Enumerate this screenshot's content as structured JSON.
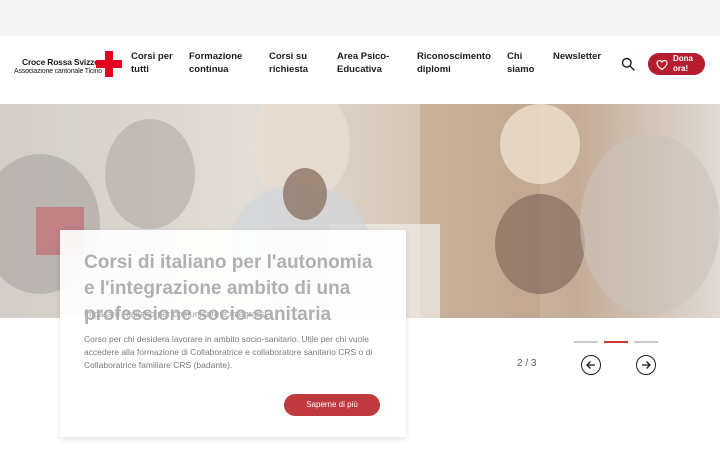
{
  "logo": {
    "name": "Croce Rossa Svizzera",
    "sub": "Associazione cantonale Ticino"
  },
  "nav": {
    "items": [
      {
        "label": "Corsi per tutti"
      },
      {
        "label": "Formazione continua"
      },
      {
        "label": "Corsi su richiesta"
      },
      {
        "label": "Area Psico-Educativa"
      },
      {
        "label": "Riconoscimento diplomi"
      },
      {
        "label": "Chi siamo"
      },
      {
        "label": "Newsletter"
      }
    ],
    "donate_label": "Dona ora!"
  },
  "colors": {
    "brand_red": "#e1001e",
    "button_red": "#b51d2e",
    "accent_red": "#c0392b"
  },
  "icons": {
    "search": "search-icon",
    "heart": "heart-icon",
    "prev": "arrow-left-icon",
    "next": "arrow-right-icon"
  },
  "slide": {
    "title": "Corsi di italiano per l'autonomia e l'integrazione ambito di una professione socio-sanitaria",
    "subtitle": "Imparare l'italiano per comunicare e integrarsi.",
    "body": "Corso per chi desidera lavorare in ambito socio-sanitario. Utile per chi vuole accedere alla formazione di Collaboratrice e collaboratore sanitario CRS o di Collaboratrice familiare CRS (badante).",
    "button_label": "Saperne di più",
    "counter": "2 / 3"
  }
}
